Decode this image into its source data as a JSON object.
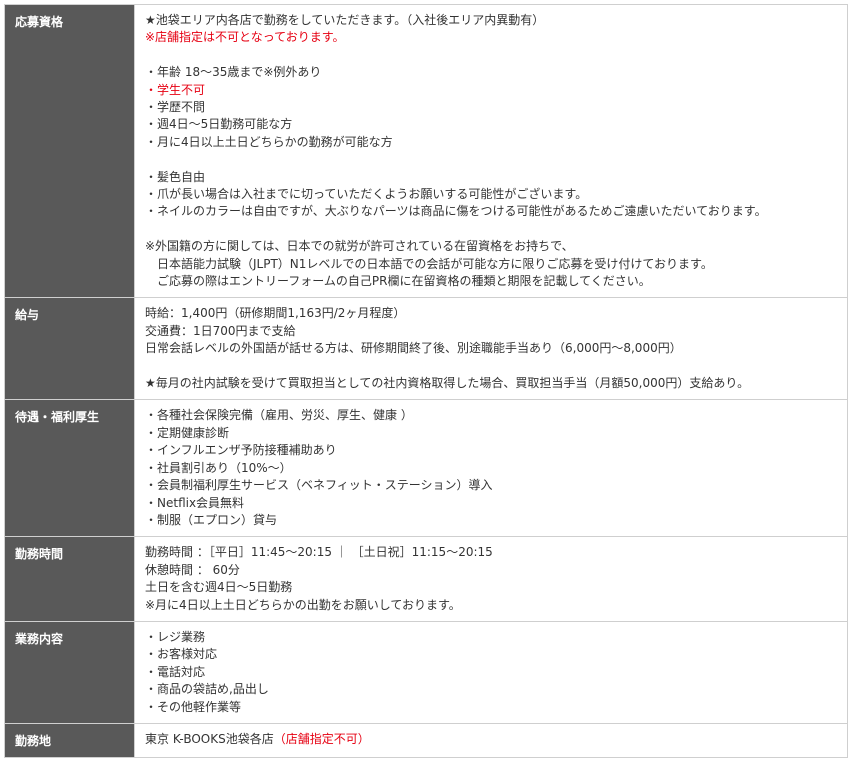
{
  "rows": [
    {
      "label": "応募資格",
      "lines": [
        {
          "text": "★池袋エリア内各店で勤務をしていただきます。（入社後エリア内異動有）"
        },
        {
          "text": "※店舗指定は不可となっております。",
          "red": true
        },
        {
          "text": ""
        },
        {
          "text": "・年齢 18〜35歳まで※例外あり"
        },
        {
          "text": "・学生不可",
          "red": true
        },
        {
          "text": "・学歴不問"
        },
        {
          "text": "・週4日〜5日勤務可能な方"
        },
        {
          "text": "・月に4日以上土日どちらかの勤務が可能な方"
        },
        {
          "text": ""
        },
        {
          "text": "・髪色自由"
        },
        {
          "text": "・爪が長い場合は入社までに切っていただくようお願いする可能性がございます。"
        },
        {
          "text": "・ネイルのカラーは自由ですが、大ぶりなパーツは商品に傷をつける可能性があるためご遠慮いただいております。"
        },
        {
          "text": ""
        },
        {
          "text": "※外国籍の方に関しては、日本での就労が許可されている在留資格をお持ちで、"
        },
        {
          "text": "　日本語能力試験（JLPT）N1レベルでの日本語での会話が可能な方に限りご応募を受け付けております。"
        },
        {
          "text": "　ご応募の際はエントリーフォームの自己PR欄に在留資格の種類と期限を記載してください。"
        }
      ]
    },
    {
      "label": "給与",
      "lines": [
        {
          "text": "時給：1,400円（研修期間1,163円/2ヶ月程度）"
        },
        {
          "text": "交通費：1日700円まで支給"
        },
        {
          "text": "日常会話レベルの外国語が話せる方は、研修期間終了後、別途職能手当あり（6,000円〜8,000円）"
        },
        {
          "text": ""
        },
        {
          "text": "★毎月の社内試験を受けて買取担当としての社内資格取得した場合、買取担当手当（月額50,000円）支給あり。"
        }
      ]
    },
    {
      "label": "待遇・福利厚生",
      "lines": [
        {
          "text": "・各種社会保険完備（雇用、労災、厚生、健康 ）"
        },
        {
          "text": "・定期健康診断"
        },
        {
          "text": "・インフルエンザ予防接種補助あり"
        },
        {
          "text": "・社員割引あり（10%〜）"
        },
        {
          "text": "・会員制福利厚生サービス（ベネフィット・ステーション）導入"
        },
        {
          "text": "・Netflix会員無料"
        },
        {
          "text": "・制服（エプロン）貸与"
        }
      ]
    },
    {
      "label": "勤務時間",
      "lines": [
        {
          "text": "勤務時間 ：［平日］11:45〜20:15 ｜ ［土日祝］11:15〜20:15"
        },
        {
          "text": "休憩時間 ： 60分"
        },
        {
          "text": "土日を含む週4日〜5日勤務"
        },
        {
          "text": "※月に4日以上土日どちらかの出勤をお願いしております。"
        }
      ]
    },
    {
      "label": "業務内容",
      "lines": [
        {
          "text": "・レジ業務"
        },
        {
          "text": "・お客様対応"
        },
        {
          "text": "・電話対応"
        },
        {
          "text": "・商品の袋詰め,品出し"
        },
        {
          "text": "・その他軽作業等"
        }
      ]
    },
    {
      "label": "勤務地",
      "lines": [
        {
          "text": "東京 K-BOOKS池袋各店",
          "suffix": "（店舗指定不可）"
        }
      ]
    }
  ]
}
